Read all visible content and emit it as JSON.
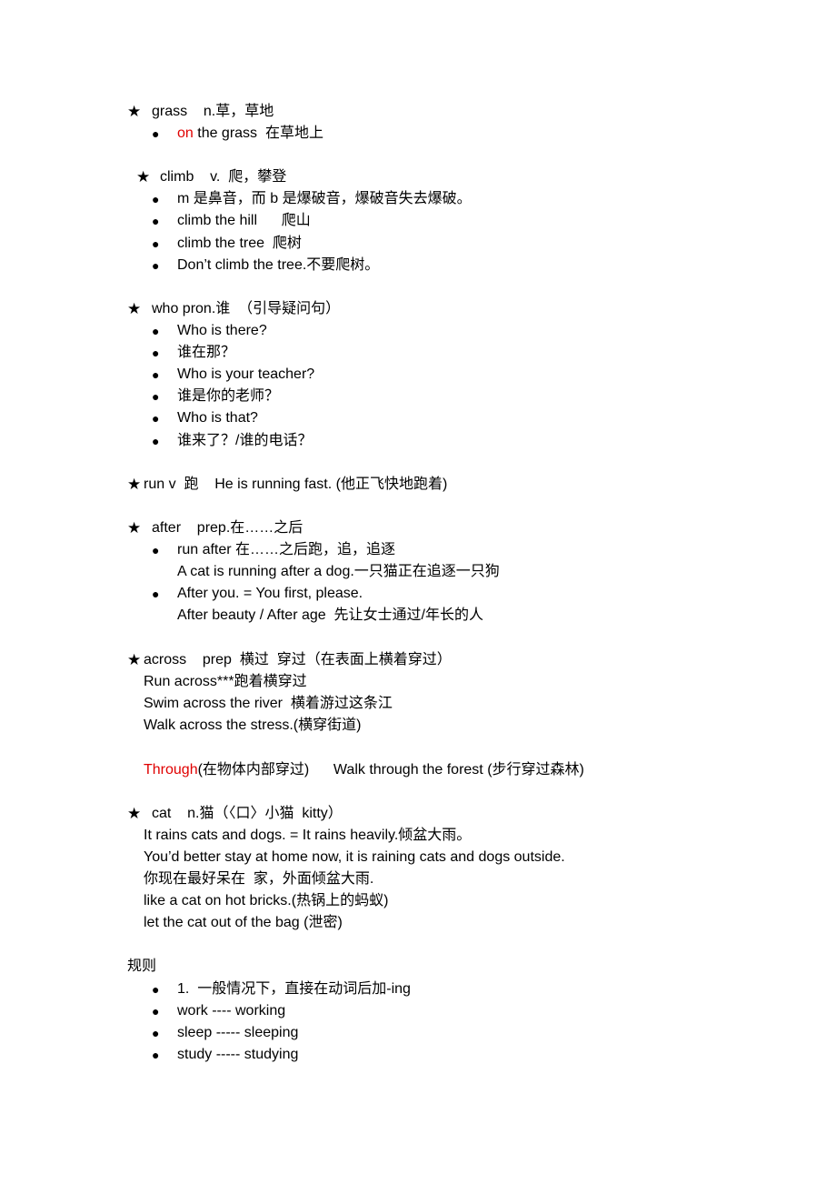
{
  "colors": {
    "text": "#000000",
    "highlight": "#e00000"
  },
  "lines": [
    {
      "kind": "star",
      "text": "grass    n.草，草地"
    },
    {
      "kind": "bullet",
      "red": "on",
      "text": " the grass  在草地上"
    },
    {
      "kind": "star2",
      "text": "climb    v.  爬，攀登"
    },
    {
      "kind": "bullet",
      "text": "m 是鼻音，而 b 是爆破音，爆破音失去爆破。"
    },
    {
      "kind": "bullet",
      "text": "climb the hill      爬山"
    },
    {
      "kind": "bullet",
      "text": "climb the tree  爬树"
    },
    {
      "kind": "bullet",
      "text": "Don’t climb the tree.不要爬树。"
    },
    {
      "kind": "star",
      "text": "who pron.谁  （引导疑问句）"
    },
    {
      "kind": "bullet",
      "text": "Who is there?"
    },
    {
      "kind": "bullet",
      "text": "谁在那？"
    },
    {
      "kind": "bullet",
      "text": "Who is your teacher?"
    },
    {
      "kind": "bullet",
      "text": "谁是你的老师？"
    },
    {
      "kind": "bullet",
      "text": "Who is that?"
    },
    {
      "kind": "bullet",
      "text": "谁来了？/谁的电话？"
    },
    {
      "kind": "startight",
      "text": "run v  跑    He is running fast. (他正飞快地跑着)"
    },
    {
      "kind": "star",
      "text": "after    prep.在……之后"
    },
    {
      "kind": "bullet",
      "text": "run after 在……之后跑，追，追逐"
    },
    {
      "kind": "bulletcont",
      "text": "A cat is running after a dog.一只猫正在追逐一只狗"
    },
    {
      "kind": "bullet",
      "text": "After you. = You first, please."
    },
    {
      "kind": "bulletcont",
      "text": "After beauty / After age  先让女士通过/年长的人"
    },
    {
      "kind": "startight",
      "text": "across    prep  横过  穿过（在表面上横着穿过）"
    },
    {
      "kind": "indent",
      "text": "Run across***跑着横穿过"
    },
    {
      "kind": "indent",
      "text": "Swim across the river  横着游过这条江"
    },
    {
      "kind": "indent",
      "text": "Walk across the stress.(横穿街道)"
    },
    {
      "kind": "indent",
      "red": "Through",
      "text": "(在物体内部穿过)      Walk through the forest (步行穿过森林)"
    },
    {
      "kind": "star",
      "text": "cat    n.猫（〈口〉小猫  kitty）"
    },
    {
      "kind": "indent",
      "text": "It rains cats and dogs. = It rains heavily.倾盆大雨。"
    },
    {
      "kind": "indent",
      "text": "You’d better stay at home now, it is raining cats and dogs outside."
    },
    {
      "kind": "indent",
      "text": "你现在最好呆在  家，外面倾盆大雨."
    },
    {
      "kind": "indent",
      "text": "like a cat on hot bricks.(热锅上的蚂蚁)"
    },
    {
      "kind": "indent",
      "text": "let the cat out of the bag (泄密)"
    },
    {
      "kind": "plain",
      "text": "规则"
    },
    {
      "kind": "bullet",
      "text": "1.  一般情况下，直接在动词后加-ing"
    },
    {
      "kind": "bullet",
      "text": "work ---- working"
    },
    {
      "kind": "bullet",
      "text": "sleep ----- sleeping"
    },
    {
      "kind": "bullet",
      "text": "study ----- studying"
    }
  ]
}
